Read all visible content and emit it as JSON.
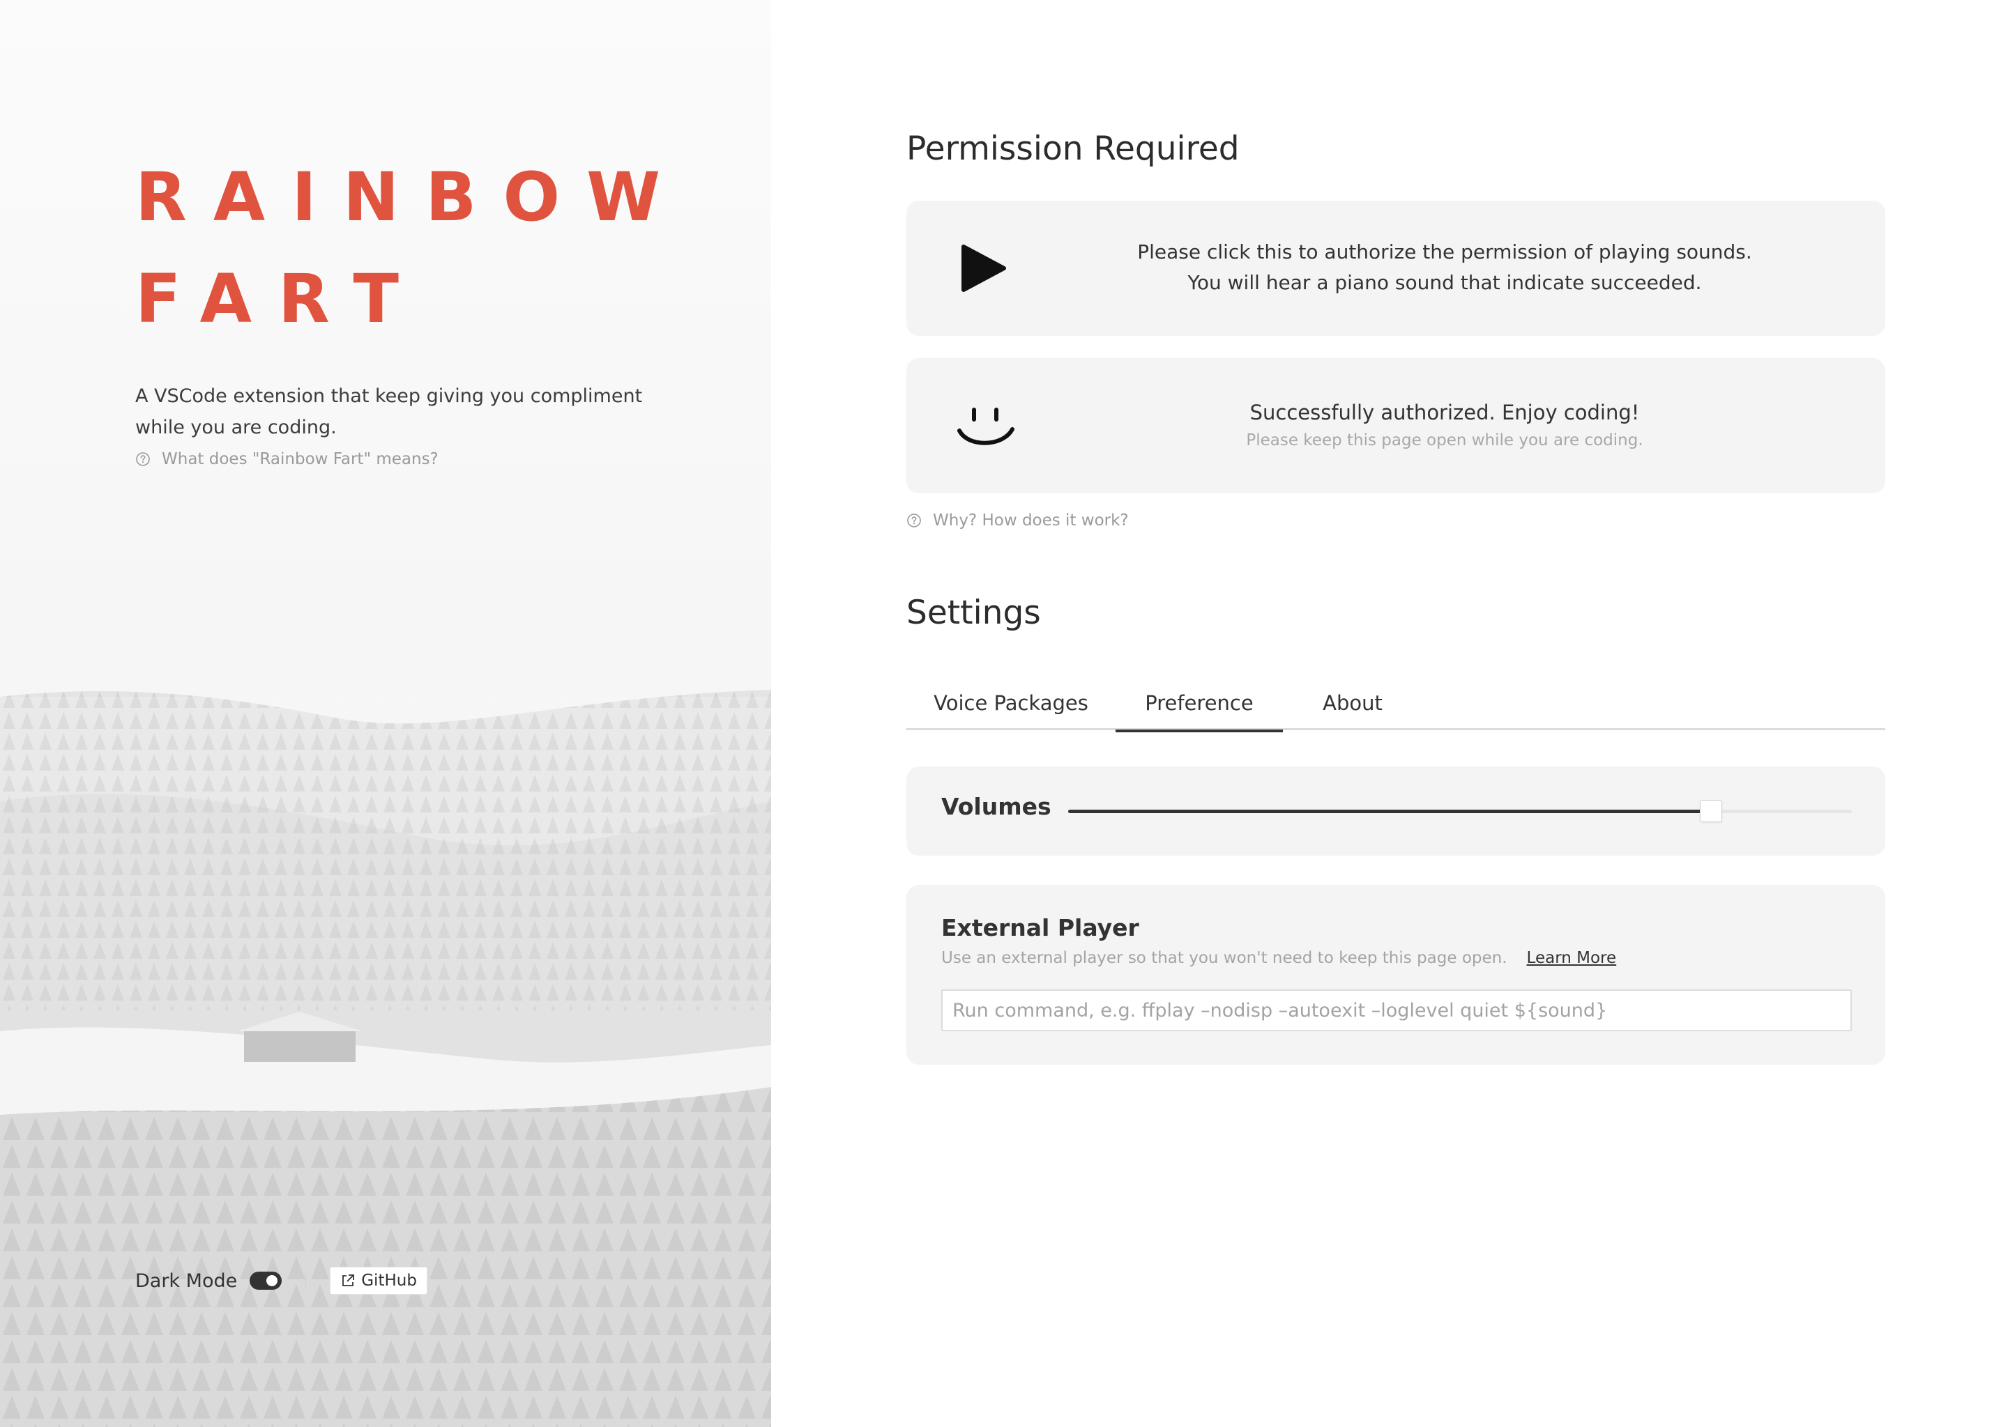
{
  "brand": {
    "line1": "RAINBOW",
    "line2": "FART",
    "accent_color": "#e0533f"
  },
  "left": {
    "tagline_line1": "A VSCode extension that keep giving you compliment",
    "tagline_line2": "while you are coding.",
    "help_icon": "question-circle-icon",
    "help_text": "What does \"Rainbow Fart\" means?",
    "dark_mode_label": "Dark Mode",
    "dark_mode_on": true,
    "github_icon": "external-link-icon",
    "github_label": "GitHub"
  },
  "permission": {
    "title": "Permission Required",
    "authorize_card": {
      "icon": "play-icon",
      "line1": "Please click this to authorize the permission of playing sounds.",
      "line2": "You will hear a piano sound that indicate succeeded."
    },
    "success_card": {
      "icon": "smile-icon",
      "main": "Successfully authorized. Enjoy coding!",
      "sub": "Please keep this page open while you are coding."
    },
    "help_text": "Why? How does it work?"
  },
  "settings": {
    "title": "Settings",
    "tabs": [
      {
        "label": "Voice Packages",
        "active": false
      },
      {
        "label": "Preference",
        "active": true
      },
      {
        "label": "About",
        "active": false
      }
    ],
    "volume": {
      "label": "Volumes",
      "value_fraction": 0.82
    },
    "external_player": {
      "title": "External Player",
      "description": "Use an external player so that you won't need to keep this page open.",
      "learn_more": "Learn More",
      "placeholder": "Run command, e.g. ffplay –nodisp –autoexit –loglevel quiet ${sound}",
      "value": ""
    }
  }
}
